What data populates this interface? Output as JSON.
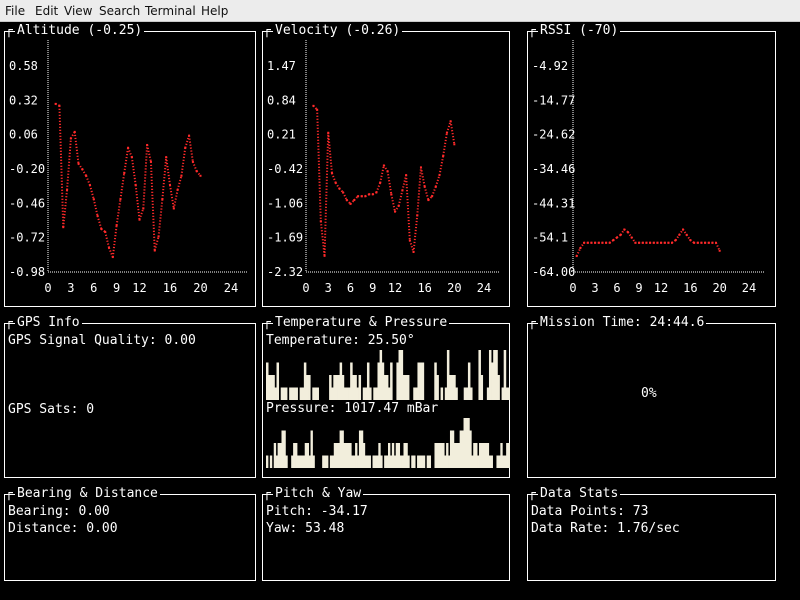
{
  "menu": [
    "File",
    "Edit",
    "View",
    "Search",
    "Terminal",
    "Help"
  ],
  "colors": {
    "background": "#000000",
    "text": "#ffffff",
    "plot_dots": "#ff2a2a",
    "bar_fill": "#f2eedc"
  },
  "panels": {
    "altitude": {
      "title": "Altitude (-0.25)"
    },
    "velocity": {
      "title": "Velocity (-0.26)"
    },
    "rssi": {
      "title": "RSSI (-70)"
    },
    "gps": {
      "title": "GPS Info",
      "signal_quality": "GPS Signal Quality: 0.00",
      "sats": "GPS Sats: 0"
    },
    "temp_pressure": {
      "title": "Temperature & Pressure",
      "temperature": "Temperature: 25.50°",
      "pressure": "Pressure: 1017.47 mBar"
    },
    "mission": {
      "title": "Mission Time: 24:44.6",
      "progress_text": "0%",
      "progress": 0
    },
    "bearing": {
      "title": "Bearing & Distance",
      "bearing": "Bearing: 0.00",
      "distance": "Distance: 0.00"
    },
    "pitch_yaw": {
      "title": "Pitch & Yaw",
      "pitch": "Pitch: -34.17",
      "yaw": "Yaw: 53.48"
    },
    "stats": {
      "title": "Data Stats",
      "points": "Data Points: 73",
      "rate": "Data Rate: 1.76/sec"
    }
  },
  "chart_data": [
    {
      "id": "altitude",
      "type": "scatter",
      "title": "Altitude (-0.25)",
      "yticks": [
        "0.58",
        "0.32",
        "0.06",
        "-0.20",
        "-0.46",
        "-0.72",
        "-0.98"
      ],
      "xticks": [
        "0",
        "3",
        "6",
        "9",
        "12",
        "16",
        "20",
        "24"
      ],
      "xlim": [
        0,
        24
      ],
      "ylim": [
        -0.98,
        0.84
      ],
      "x": [
        1,
        1.5,
        2,
        2.5,
        3,
        3.5,
        4,
        4.5,
        5,
        5.5,
        6,
        6.5,
        7,
        7.5,
        8,
        8.5,
        9,
        9.5,
        10,
        10.5,
        11,
        11.5,
        12,
        12.5,
        13,
        13.5,
        14,
        14.5,
        15,
        15.5,
        16,
        16.5,
        17,
        17.5,
        18,
        18.5,
        19,
        19.5,
        20
      ],
      "y": [
        0.82,
        0.8,
        -0.5,
        -0.1,
        0.45,
        0.52,
        0.18,
        0.12,
        0.05,
        -0.05,
        -0.2,
        -0.38,
        -0.52,
        -0.55,
        -0.72,
        -0.82,
        -0.48,
        -0.2,
        0.08,
        0.35,
        0.25,
        -0.05,
        -0.42,
        -0.3,
        0.38,
        0.2,
        -0.75,
        -0.6,
        -0.2,
        0.25,
        -0.05,
        -0.3,
        -0.1,
        0.05,
        0.35,
        0.48,
        0.2,
        0.1,
        0.05
      ]
    },
    {
      "id": "velocity",
      "type": "scatter",
      "title": "Velocity (-0.26)",
      "yticks": [
        "1.47",
        "0.84",
        "0.21",
        "-0.42",
        "-1.06",
        "-1.69",
        "-2.32"
      ],
      "xticks": [
        "0",
        "3",
        "6",
        "9",
        "12",
        "16",
        "20",
        "24"
      ],
      "xlim": [
        0,
        24
      ],
      "ylim": [
        -2.32,
        2.1
      ],
      "x": [
        1,
        1.5,
        2,
        2.5,
        3,
        3.5,
        4,
        4.5,
        5,
        5.5,
        6,
        6.5,
        7,
        7.5,
        8,
        8.5,
        9,
        9.5,
        10,
        10.5,
        11,
        11.5,
        12,
        12.5,
        13,
        13.5,
        14,
        14.5,
        15,
        15.5,
        16,
        16.5,
        17,
        17.5,
        18,
        18.5,
        19,
        19.5,
        20
      ],
      "y": [
        2.0,
        1.9,
        -1.0,
        -1.9,
        1.3,
        0.25,
        0.0,
        -0.15,
        -0.25,
        -0.45,
        -0.55,
        -0.45,
        -0.35,
        -0.35,
        -0.35,
        -0.3,
        -0.3,
        -0.25,
        0.0,
        0.45,
        0.3,
        -0.3,
        -0.75,
        -0.6,
        -0.2,
        0.2,
        -1.5,
        -1.8,
        -0.85,
        0.4,
        -0.1,
        -0.45,
        -0.35,
        -0.1,
        0.2,
        0.7,
        1.3,
        1.6,
        1.0
      ]
    },
    {
      "id": "rssi",
      "type": "scatter",
      "title": "RSSI (-70)",
      "yticks": [
        "-4.92",
        "-14.77",
        "-24.62",
        "-34.46",
        "-44.31",
        "-54.1",
        "-64.00"
      ],
      "xticks": [
        "0",
        "3",
        "6",
        "9",
        "12",
        "16",
        "20",
        "24"
      ],
      "xlim": [
        0,
        24
      ],
      "ylim": [
        -64,
        0
      ],
      "x": [
        0.5,
        1,
        1.5,
        2,
        2.5,
        3,
        3.5,
        4,
        4.5,
        5,
        5.5,
        6,
        6.5,
        7,
        7.5,
        8,
        8.5,
        9,
        9.5,
        10,
        10.5,
        11,
        11.5,
        12,
        12.5,
        13,
        13.5,
        14,
        14.5,
        15,
        15.5,
        16,
        16.5,
        17,
        17.5,
        18,
        18.5,
        19,
        19.5,
        20
      ],
      "y": [
        -58,
        -55,
        -53,
        -53,
        -53,
        -53,
        -53,
        -53,
        -53,
        -53,
        -52,
        -51,
        -50,
        -48,
        -49,
        -51,
        -53,
        -53,
        -53,
        -53,
        -53,
        -53,
        -53,
        -53,
        -53,
        -53,
        -53,
        -52,
        -50,
        -48,
        -50,
        -52,
        -53,
        -53,
        -53,
        -53,
        -53,
        -53,
        -53,
        -56
      ]
    },
    {
      "id": "temperature",
      "type": "bar",
      "title": "Temperature: 25.50°",
      "values": [
        3,
        2,
        2,
        2,
        1,
        3,
        0,
        1,
        1,
        1,
        0,
        1,
        1,
        1,
        1,
        0,
        1,
        1,
        3,
        2,
        2,
        0,
        1,
        1,
        1,
        0,
        0,
        0,
        0,
        0,
        2,
        1,
        2,
        2,
        2,
        3,
        2,
        1,
        1,
        1,
        3,
        2,
        2,
        1,
        2,
        0,
        1,
        1,
        3,
        1,
        0,
        1,
        1,
        3,
        4,
        3,
        2,
        2,
        1,
        3,
        0,
        0,
        3,
        4,
        4,
        2,
        2,
        2,
        0,
        0,
        1,
        1,
        3,
        3,
        3,
        0,
        0,
        0,
        0,
        0,
        3,
        2,
        0,
        1,
        0,
        1,
        4,
        2,
        2,
        2,
        1,
        0,
        0,
        0,
        1,
        1,
        3,
        1,
        0,
        0,
        0,
        4,
        2,
        0,
        0,
        1,
        4,
        3,
        4,
        4,
        2,
        0,
        1,
        4,
        1,
        1
      ],
      "ymax": 4
    },
    {
      "id": "pressure",
      "type": "bar",
      "title": "Pressure: 1017.47 mBar",
      "values": [
        1,
        0,
        1,
        0,
        2,
        1,
        2,
        2,
        3,
        3,
        1,
        0,
        0,
        1,
        2,
        2,
        1,
        1,
        1,
        1,
        2,
        2,
        1,
        3,
        1,
        0,
        0,
        0,
        0,
        1,
        1,
        1,
        0,
        1,
        1,
        2,
        2,
        2,
        3,
        3,
        2,
        2,
        2,
        2,
        1,
        1,
        2,
        1,
        3,
        3,
        2,
        1,
        1,
        1,
        0,
        1,
        1,
        1,
        2,
        1,
        0,
        1,
        1,
        2,
        1,
        2,
        1,
        2,
        2,
        1,
        1,
        2,
        2,
        1,
        0,
        1,
        1,
        0,
        1,
        1,
        1,
        1,
        0,
        1,
        1,
        0,
        0,
        2,
        2,
        2,
        2,
        2,
        1,
        2,
        1,
        3,
        3,
        2,
        2,
        2,
        3,
        3,
        4,
        4,
        4,
        3,
        1,
        2,
        2,
        1,
        2,
        2,
        2,
        2,
        2,
        1,
        1,
        0,
        0,
        1,
        1,
        2,
        1,
        1,
        2,
        2
      ],
      "ymax": 4
    }
  ]
}
